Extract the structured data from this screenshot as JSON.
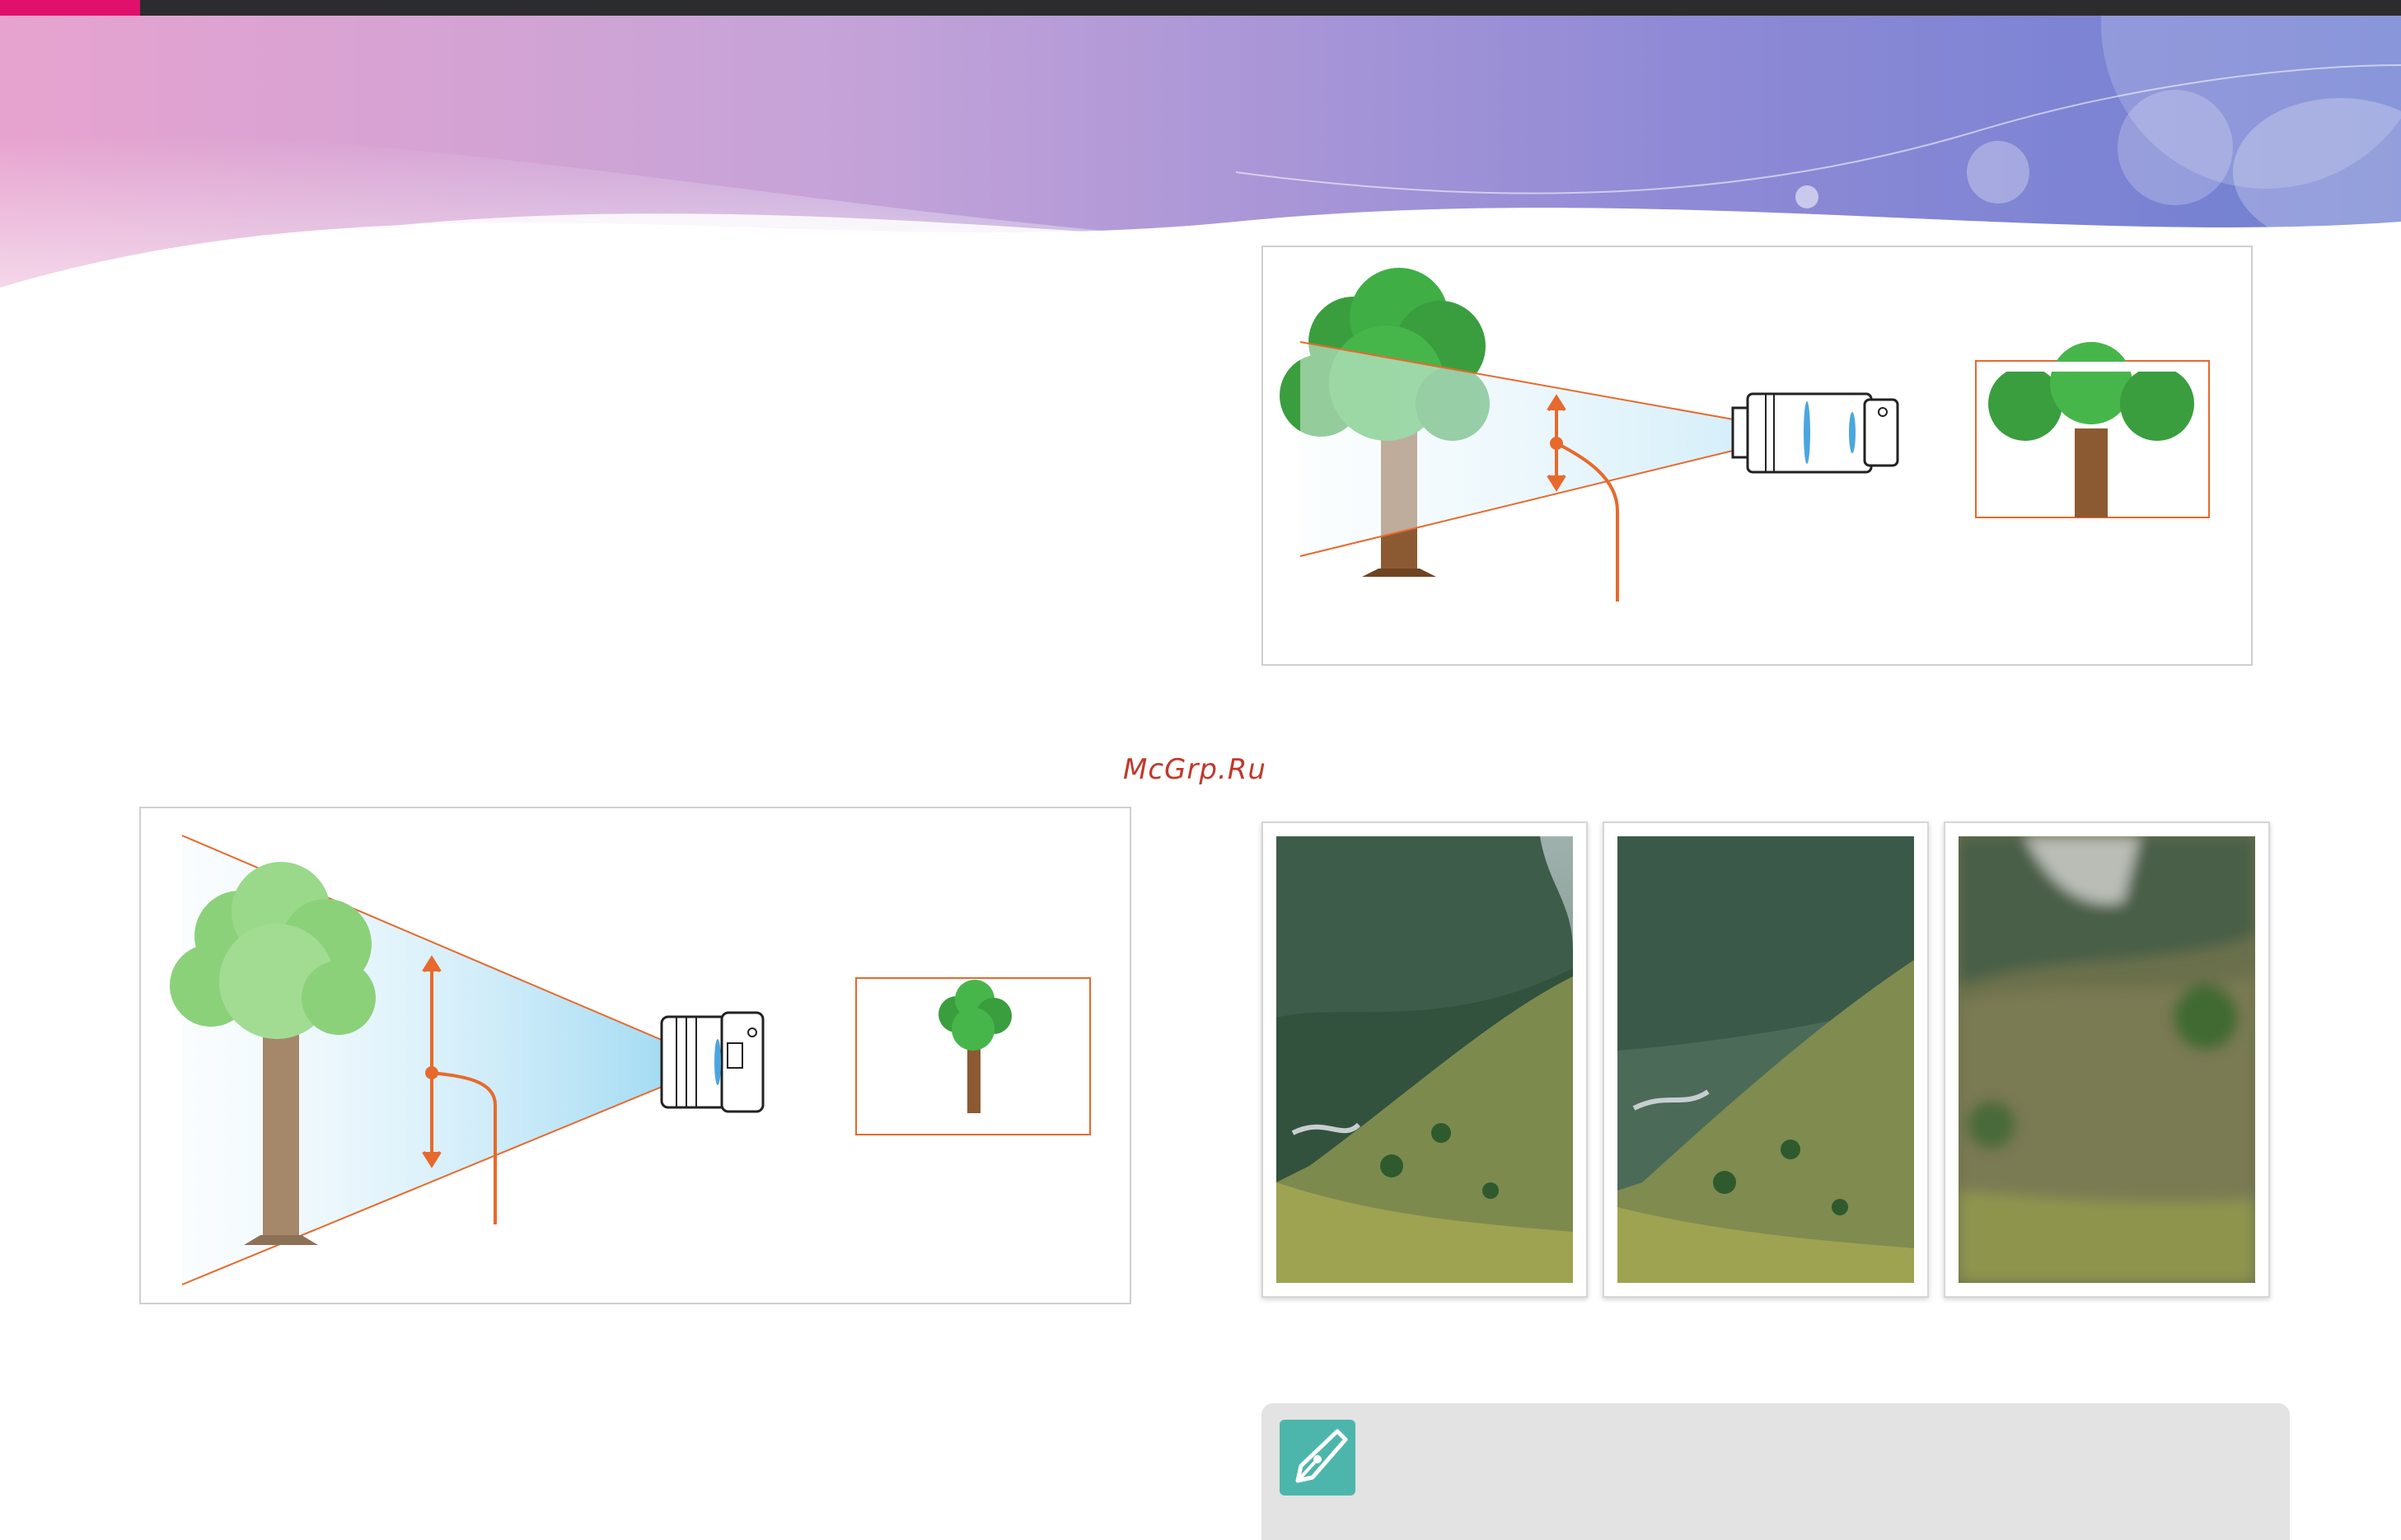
{
  "watermark": "McGrp.Ru",
  "colors": {
    "accent": "#e0116c",
    "topbar": "#2c2c2e",
    "guide_lines": "#e8692c",
    "note_icon": "#4db6ac",
    "note_box": "#e3e3e3"
  },
  "icons": {
    "note": "pen-nib-icon"
  }
}
